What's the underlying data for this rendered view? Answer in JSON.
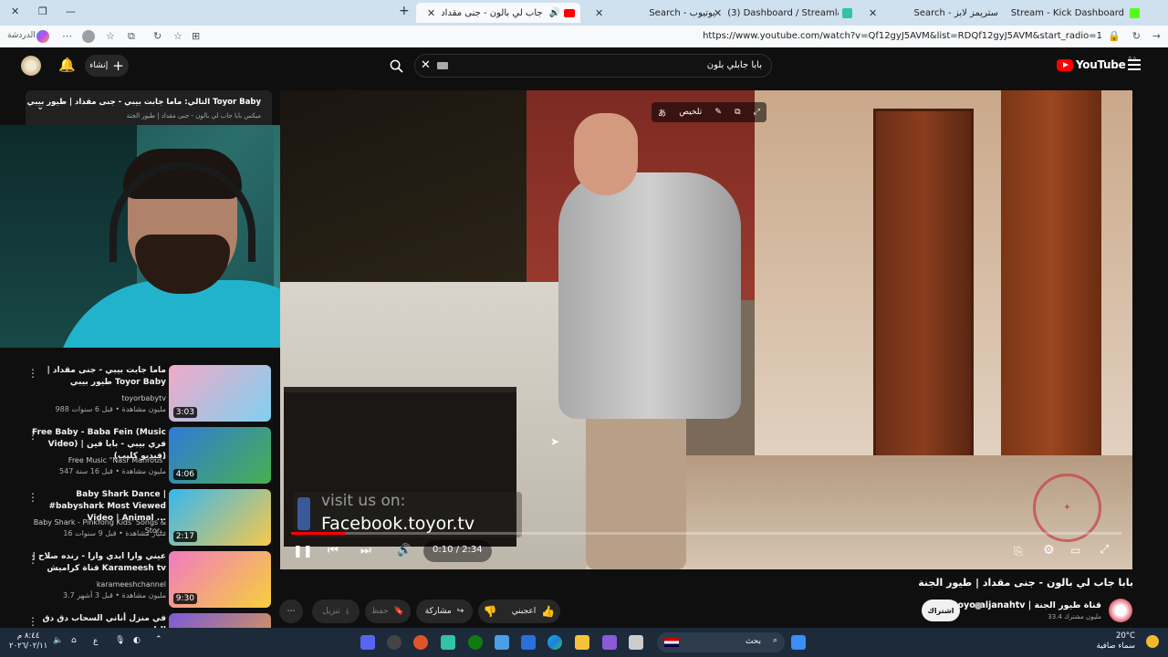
{
  "browser": {
    "tabs": [
      {
        "label": "بابا جاب لي بالون - جنى مقداد"
      },
      {
        "label": "Search - يوتيوب"
      },
      {
        "label": "(3) Dashboard / Streamlabs"
      },
      {
        "label": "Search - ستريمز لابز"
      },
      {
        "label": "Stream - Kick Dashboard"
      }
    ],
    "url": "https://www.youtube.com/watch?v=Qf12gyJ5AVM&list=RDQf12gyJ5AVM&start_radio=1",
    "profile_label": "الدردشة"
  },
  "youtube": {
    "logo_text": "YouTube",
    "region": "SA",
    "create_label": "إنشاء",
    "search_query": "بابا جابلي بلون"
  },
  "playlist_panel": {
    "next_label": "التالي: ماما جابت بيبي - جنى مقداد | طيور بيبي Toyor Baby",
    "sub_label": "ميكس بابا جاب لي بالون - جنى مقداد | طيور الجنة"
  },
  "player": {
    "overlay_text1": "visit us on:",
    "overlay_text2": "Facebook.toyor.tv",
    "summary_label": "تلخيص",
    "time": "0:10 / 2:34",
    "progress": 0.065
  },
  "video": {
    "title": "بابا جاب لي بالون - جنى مقداد | طيور الجنة",
    "channel": "toyoraljanahtv | قناة طيور الجنة",
    "subscribers": "33.4 مليون مشترك",
    "subscribe_label": "اشتراك",
    "like_label": "اعجبني",
    "share_label": "مشاركة",
    "save_label": "حفظ",
    "download_label": "تنزيل"
  },
  "recommendations": [
    {
      "title": "ماما جابت بيبي - جنى مقداد | طيور بيبي Toyor Baby",
      "channel": "toyorbabytv",
      "meta": "988 مليون مشاهدة • قبل 6 سنوات",
      "duration": "3:03",
      "colors": [
        "#f2a9c8",
        "#7fd0f0"
      ]
    },
    {
      "title": "Free Baby - Baba Fein (Music Video) | فري بيبي - بابا فين (فيديو كليب)",
      "channel": "Free Music \"Nasr Mahrous\"",
      "meta": "547 مليون مشاهدة • قبل 16 سنة",
      "duration": "4:06",
      "colors": [
        "#2f7ad8",
        "#48b04f"
      ]
    },
    {
      "title": "Baby Shark Dance | #babyshark Most Viewed Video | Animal ...",
      "channel": "Baby Shark - Pinkfong Kids' Songs & Stor...",
      "meta": "16 مليار مشاهدة • قبل 9 سنوات",
      "duration": "2:17",
      "colors": [
        "#36b7f0",
        "#f6c94b"
      ]
    },
    {
      "title": "عيني وارا ايدي وارا - رنده صلاح | قناة كراميش Karameesh tv",
      "channel": "karameeshchannel",
      "meta": "3.7 مليون مشاهدة • قبل 3 أشهر",
      "duration": "9:30",
      "colors": [
        "#f27ac0",
        "#f5d03c"
      ]
    },
    {
      "title": "في منزل أناني السحاب دق دق الباب",
      "channel": "",
      "meta": "",
      "duration": "",
      "colors": [
        "#7a5ad8",
        "#e8a040"
      ]
    }
  ],
  "taskbar": {
    "search_label": "بحث",
    "weather_temp": "20°C",
    "weather_desc": "سماء صافية",
    "clock_time": "٨:٤٤ م",
    "clock_date": "٢٠٢٦/٠٢/١١",
    "lang": "ع"
  }
}
